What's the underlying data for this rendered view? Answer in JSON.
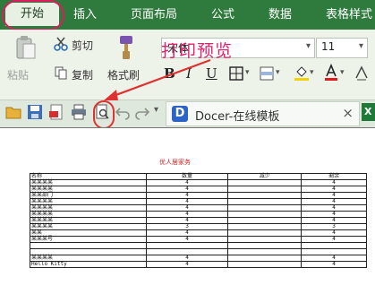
{
  "ribbon_tabs": [
    "开始",
    "插入",
    "页面布局",
    "公式",
    "数据",
    "表格样式"
  ],
  "ribbon": {
    "paste_label": "粘贴",
    "cut_label": "剪切",
    "copy_label": "复制",
    "format_painter_label": "格式刷",
    "font_name": "宋体",
    "font_size": "11",
    "format_glyphs": {
      "bold": "B",
      "italic": "I",
      "underline": "U"
    }
  },
  "annotation_label": "打印预览",
  "quick_access": {
    "doc_tab_label": "Docer-在线模板",
    "close_glyph": "×"
  },
  "preview": {
    "title": "优人居家务",
    "headers": [
      "名称",
      "数量",
      "减少",
      "剩余"
    ],
    "rows": [
      [
        "某某某某",
        "4",
        "",
        "4"
      ],
      [
        "某某某某",
        "4",
        "",
        "4"
      ],
      [
        "某某部门",
        "4",
        "",
        "4"
      ],
      [
        "某某某某",
        "4",
        "",
        "4"
      ],
      [
        "某某某某",
        "4",
        "",
        "4"
      ],
      [
        "某某某某",
        "4",
        "",
        "4"
      ],
      [
        "某某某某",
        "4",
        "",
        "4"
      ],
      [
        "某某某某",
        "3",
        "",
        "3"
      ],
      [
        "某某",
        "4",
        "",
        "4"
      ],
      [
        "某某某号",
        "4",
        "",
        "4"
      ],
      [
        "",
        "",
        "",
        ""
      ],
      [
        "",
        "",
        "",
        ""
      ],
      [
        "某某某某",
        "4",
        "",
        "4"
      ],
      [
        "Hello Kitty",
        "4",
        "",
        "4"
      ]
    ]
  },
  "colors": {
    "ribbon_tab_bg": "#2f7a3d",
    "annotation": "#e0226c",
    "highlight_ring": "#e03131"
  }
}
